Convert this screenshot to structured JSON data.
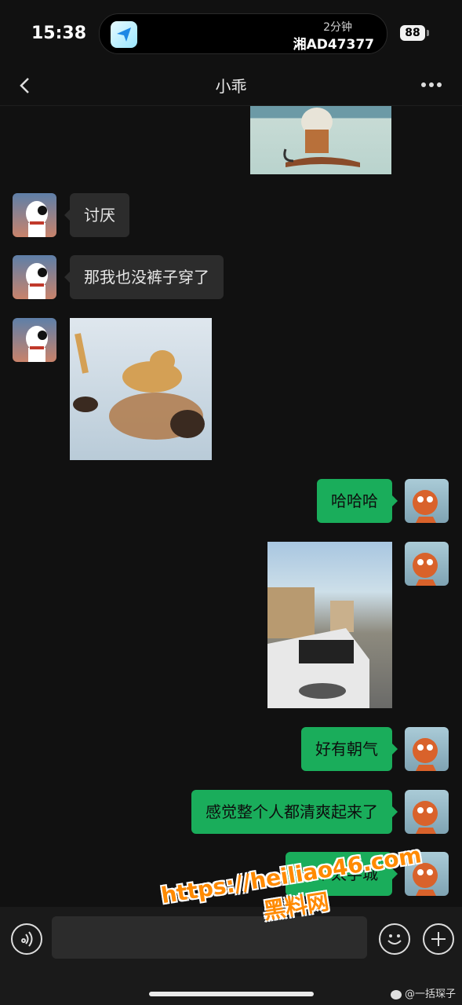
{
  "status_bar": {
    "time": "15:38",
    "island_duration": "2分钟",
    "island_plate": "湘AD47377",
    "battery": "88"
  },
  "nav": {
    "title": "小乖",
    "back_icon": "chevron-left-icon",
    "more_icon": "more-dots-icon"
  },
  "messages": [
    {
      "side": "right",
      "type": "image",
      "desc_icon": "cartoon-image"
    },
    {
      "side": "left",
      "type": "text",
      "text": "讨厌"
    },
    {
      "side": "left",
      "type": "text",
      "text": "那我也没裤子穿了"
    },
    {
      "side": "left",
      "type": "image",
      "desc_icon": "pool-dog-photo"
    },
    {
      "side": "right",
      "type": "text",
      "text": "哈哈哈"
    },
    {
      "side": "right",
      "type": "image",
      "desc_icon": "street-car-photo"
    },
    {
      "side": "right",
      "type": "text",
      "text": "好有朝气"
    },
    {
      "side": "right",
      "type": "text",
      "text": "感觉整个人都清爽起来了"
    },
    {
      "side": "right",
      "type": "text",
      "text": "这个太学城"
    }
  ],
  "watermark": {
    "url": "https://heiliao46.com",
    "name": "黑料网"
  },
  "input_bar": {
    "placeholder": "",
    "voice_icon": "voice-icon",
    "emoji_icon": "emoji-icon",
    "plus_icon": "plus-icon"
  },
  "credit": "@一括琛子",
  "colors": {
    "background": "#111111",
    "bubble_out": "#1aad5b",
    "bubble_in": "#2c2c2c",
    "watermark": "#ff8a00"
  }
}
